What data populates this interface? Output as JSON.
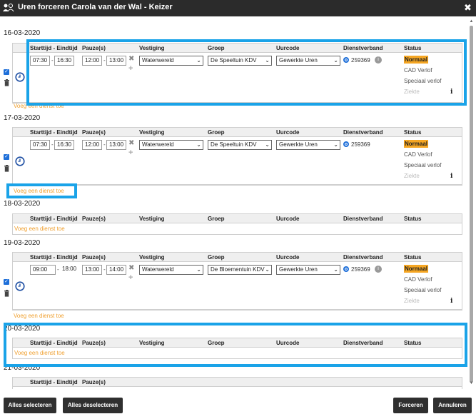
{
  "window": {
    "title": "Uren forceren Carola van der Wal - Keizer",
    "close_label": "✖"
  },
  "headers": {
    "start_end": "Starttijd - Eindtijd",
    "pause": "Pauze(s)",
    "vestiging": "Vestiging",
    "groep": "Groep",
    "uurcode": "Uurcode",
    "dienstverband": "Dienstverband",
    "status": "Status"
  },
  "add_label": "Voeg een dienst toe",
  "status_options": [
    "Normaal",
    "CAD Verlof",
    "Speciaal verlof",
    "Ziekte"
  ],
  "days": [
    {
      "date": "16-03-2020",
      "entry": {
        "start": "07:30",
        "end": "16:30",
        "pause_start": "12:00",
        "pause_end": "13:00",
        "vestiging": "Waterwereld",
        "groep": "De Speeltuin KDV",
        "uurcode": "Gewerkte Uren",
        "dienstverband": "259369",
        "status": "Normaal"
      }
    },
    {
      "date": "17-03-2020",
      "entry": {
        "start": "07:30",
        "end": "16:30",
        "pause_start": "12:00",
        "pause_end": "13:00",
        "vestiging": "Waterwereld",
        "groep": "De Speeltuin KDV",
        "uurcode": "Gewerkte Uren",
        "dienstverband": "259369",
        "status": "Normaal"
      }
    },
    {
      "date": "18-03-2020"
    },
    {
      "date": "19-03-2020",
      "entry": {
        "start": "09:00",
        "end": "18:00",
        "pause_start": "13:00",
        "pause_end": "14:00",
        "vestiging": "Waterwereld",
        "groep": "De Bloementuin KDV",
        "uurcode": "Gewerkte Uren",
        "dienstverband": "259369",
        "status": "Normaal"
      }
    },
    {
      "date": "20-03-2020"
    },
    {
      "date": "21-03-2020"
    }
  ],
  "footer": {
    "select_all": "Alles selecteren",
    "deselect_all": "Alles deselecteren",
    "force": "Forceren",
    "cancel": "Annuleren"
  },
  "colors": {
    "highlight": "#1aa3e8",
    "status_active": "#f5a623",
    "add_link": "#f0a030",
    "titlebar": "#2b2b2b"
  }
}
